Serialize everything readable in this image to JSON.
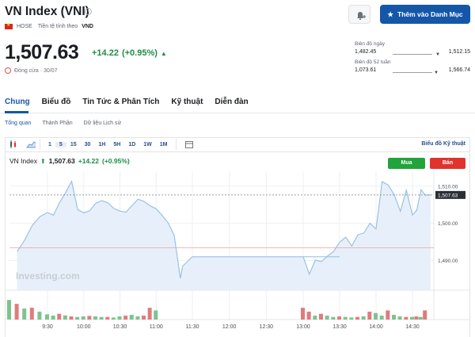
{
  "header": {
    "title": "VN Index (VNI)",
    "watchlist_label": "Thêm vào Danh Mục",
    "exchange": "HOSE",
    "currency_text": "Tiền tệ tính theo",
    "currency": "VND"
  },
  "quote": {
    "price": "1,507.63",
    "change": "+14.22",
    "change_pct": "(+0.95%)",
    "status": "Đóng cửa · 30/07"
  },
  "ranges": {
    "day": {
      "label": "Biên độ ngày",
      "low": "1,482.45",
      "high": "1,512.15"
    },
    "week52": {
      "label": "Biên độ 52 tuần",
      "low": "1,073.61",
      "high": "1,566.74"
    }
  },
  "tabs": [
    "Chung",
    "Biểu đồ",
    "Tin Tức & Phân Tích",
    "Kỹ thuật",
    "Diễn đàn"
  ],
  "subtabs": [
    "Tổng quan",
    "Thành Phần",
    "Dữ liệu Lịch sử"
  ],
  "toolbar": {
    "timeframes": [
      "1",
      "5",
      "15",
      "30",
      "1H",
      "5H",
      "1D",
      "1W",
      "1M"
    ],
    "selected": "5",
    "advanced_link": "Biểu đồ Kỹ thuật"
  },
  "chart_legend": {
    "name": "VN Index",
    "price": "1,507.63",
    "change": "+14.22",
    "change_pct": "(+0.95%)"
  },
  "buttons": {
    "buy": "Mua",
    "sell": "Bán"
  },
  "colors": {
    "up": "#1d8d46",
    "down": "#e0332d",
    "line": "#9ac1e6",
    "area": "#e7f0fa",
    "accent": "#1457a8"
  },
  "chart_data": {
    "type": "area",
    "watermark": "Investing.com",
    "x_ticks": [
      "9:30",
      "10:00",
      "10:30",
      "11:00",
      "11:30",
      "12:00",
      "12:30",
      "13:00",
      "13:30",
      "14:00",
      "14:30"
    ],
    "y_ticks": [
      "1,510.00",
      "1,500.00",
      "1,490.00"
    ],
    "last_value_label": "1,507.63",
    "ylim": [
      1482,
      1514
    ],
    "reference_close": 1493.41,
    "session_segments": [
      {
        "start": "9:10",
        "step_minutes": 5,
        "values": [
          1492.4,
          1495.5,
          1499.4,
          1501.8,
          1502.9,
          1502.2,
          1505.6,
          1508.3,
          1511.3,
          1503.7,
          1502.8,
          1503.4,
          1505.4,
          1506.1,
          1505.5,
          1504.0,
          1503.3,
          1503.0,
          1504.8,
          1506.5,
          1505.9,
          1504.7,
          1503.9,
          1502.1,
          1500.1,
          1496.7,
          1485.2
        ]
      },
      {
        "start": "11:22",
        "values": [
          1488.5,
          1491.0,
          1491.0
        ]
      },
      {
        "start": "13:00",
        "step_minutes": 5,
        "values": [
          1491.0,
          1486.3,
          1490.1,
          1489.7,
          1491.2,
          1492.4,
          1494.9,
          1496.3,
          1493.9,
          1496.9,
          1497.4,
          1500.0,
          1498.5,
          1511.2,
          1510.3,
          1507.7,
          1503.2,
          1508.9,
          1502.2,
          1503.5,
          1509.0,
          1507.6
        ]
      }
    ],
    "volume": {
      "morning": {
        "start": "9:05",
        "step_minutes": 5,
        "values": [
          0.75,
          0.6,
          0.42,
          0.45,
          0.3,
          0.2,
          0.15,
          0.22,
          0.16,
          0.12,
          0.1,
          0.12,
          0.14,
          0.12,
          0.1,
          0.1,
          0.08,
          0.12,
          0.15,
          0.18,
          0.12,
          0.15,
          0.45,
          0.35
        ],
        "colors": [
          "g",
          "r",
          "g",
          "r",
          "g",
          "g",
          "g",
          "r",
          "g",
          "r",
          "g",
          "g",
          "r",
          "g",
          "g",
          "r",
          "g",
          "g",
          "r",
          "g",
          "g",
          "r",
          "r",
          "g"
        ]
      },
      "afternoon": {
        "start": "13:00",
        "step_minutes": 5,
        "values": [
          0.45,
          0.3,
          0.15,
          0.22,
          0.15,
          0.1,
          0.12,
          0.1,
          0.08,
          0.1,
          0.12,
          0.3,
          0.25,
          0.15,
          0.35,
          0.18,
          0.12,
          0.1,
          0.1,
          0.12,
          0.1,
          0.35
        ],
        "colors": [
          "r",
          "r",
          "g",
          "r",
          "g",
          "g",
          "r",
          "g",
          "g",
          "r",
          "g",
          "r",
          "g",
          "g",
          "r",
          "g",
          "g",
          "r",
          "g",
          "r",
          "g",
          "r"
        ]
      }
    }
  }
}
